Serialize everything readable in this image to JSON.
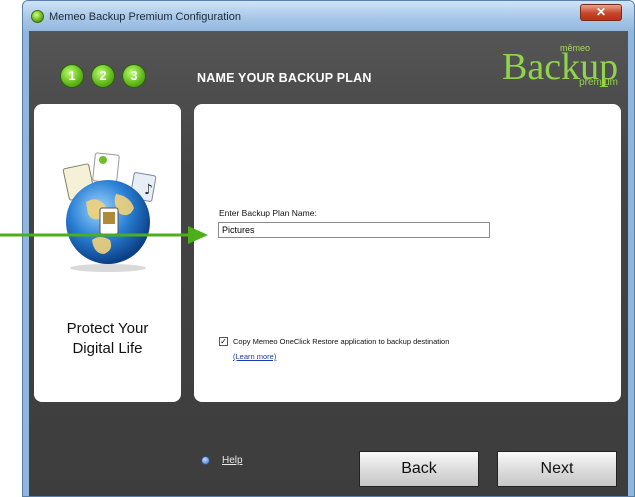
{
  "window": {
    "title": "Memeo Backup Premium Configuration",
    "close_glyph": "✕"
  },
  "steps": [
    "1",
    "2",
    "3"
  ],
  "heading": "NAME YOUR BACKUP PLAN",
  "logo": {
    "brand_small": "mēmeo",
    "brand": "Backup",
    "edition": "premium"
  },
  "left_panel": {
    "caption_line1": "Protect Your",
    "caption_line2": "Digital Life"
  },
  "form": {
    "plan_name_label": "Enter Backup Plan Name:",
    "plan_name_value": "Pictures",
    "copy_restore_checked": true,
    "copy_restore_label": "Copy Memeo OneClick Restore application to backup destination",
    "learn_more_link": "(Learn more)"
  },
  "footer": {
    "help_label": "Help",
    "back_label": "Back",
    "next_label": "Next"
  },
  "colors": {
    "accent_green": "#8fd44a",
    "panel_dark": "#444444",
    "annotation_arrow": "#4caf1a"
  }
}
